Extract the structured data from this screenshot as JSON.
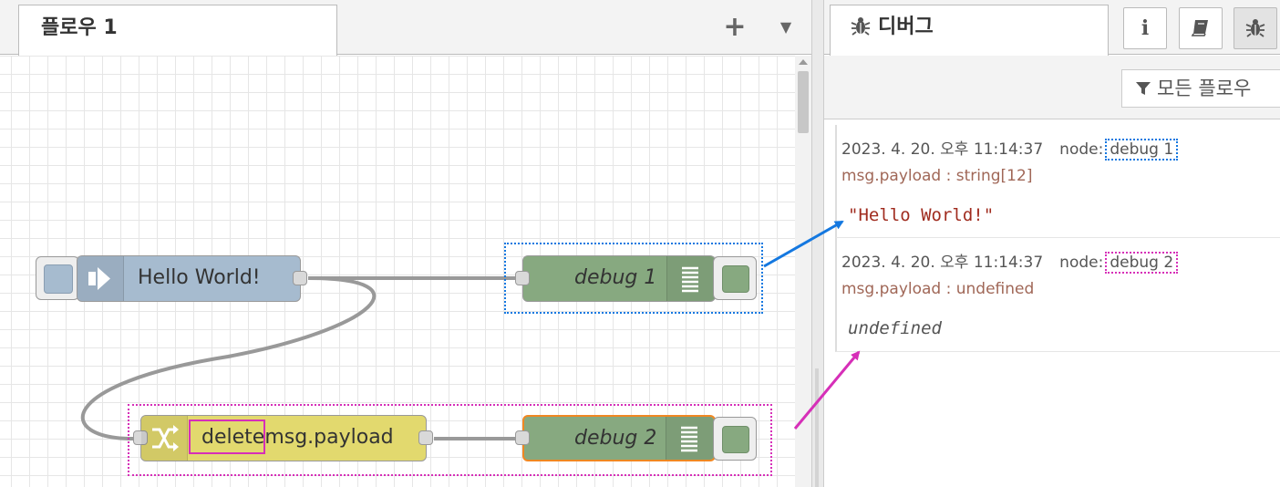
{
  "workspace": {
    "tab_label": "플로우 1",
    "add_flow_glyph": "+",
    "flow_menu_glyph": "▼"
  },
  "nodes": {
    "inject": {
      "label": "Hello World!",
      "color": "#a6bbcf"
    },
    "debug1": {
      "label": "debug 1",
      "color": "#87a980"
    },
    "change": {
      "label_highlight": "delete",
      "label_rest": "msg.payload",
      "color": "#e2d96e"
    },
    "debug2": {
      "label": "debug 2",
      "color": "#87a980",
      "selected_color": "#f08722"
    }
  },
  "sidebar": {
    "debug_tab_label": "디버그",
    "info_glyph": "i",
    "filter_label": "모든 플로우",
    "messages": [
      {
        "timestamp": "2023. 4. 20. 오후 11:14:37",
        "node_label": "node:",
        "node_name": "debug 1",
        "property": "msg.payload : string[12]",
        "value": "\"Hello World!\""
      },
      {
        "timestamp": "2023. 4. 20. 오후 11:14:37",
        "node_label": "node:",
        "node_name": "debug 2",
        "property": "msg.payload : undefined",
        "value": "undefined"
      }
    ]
  },
  "colors": {
    "highlight_debug1": "#1478e0",
    "highlight_debug2": "#d62fb8",
    "wire": "#999999"
  }
}
